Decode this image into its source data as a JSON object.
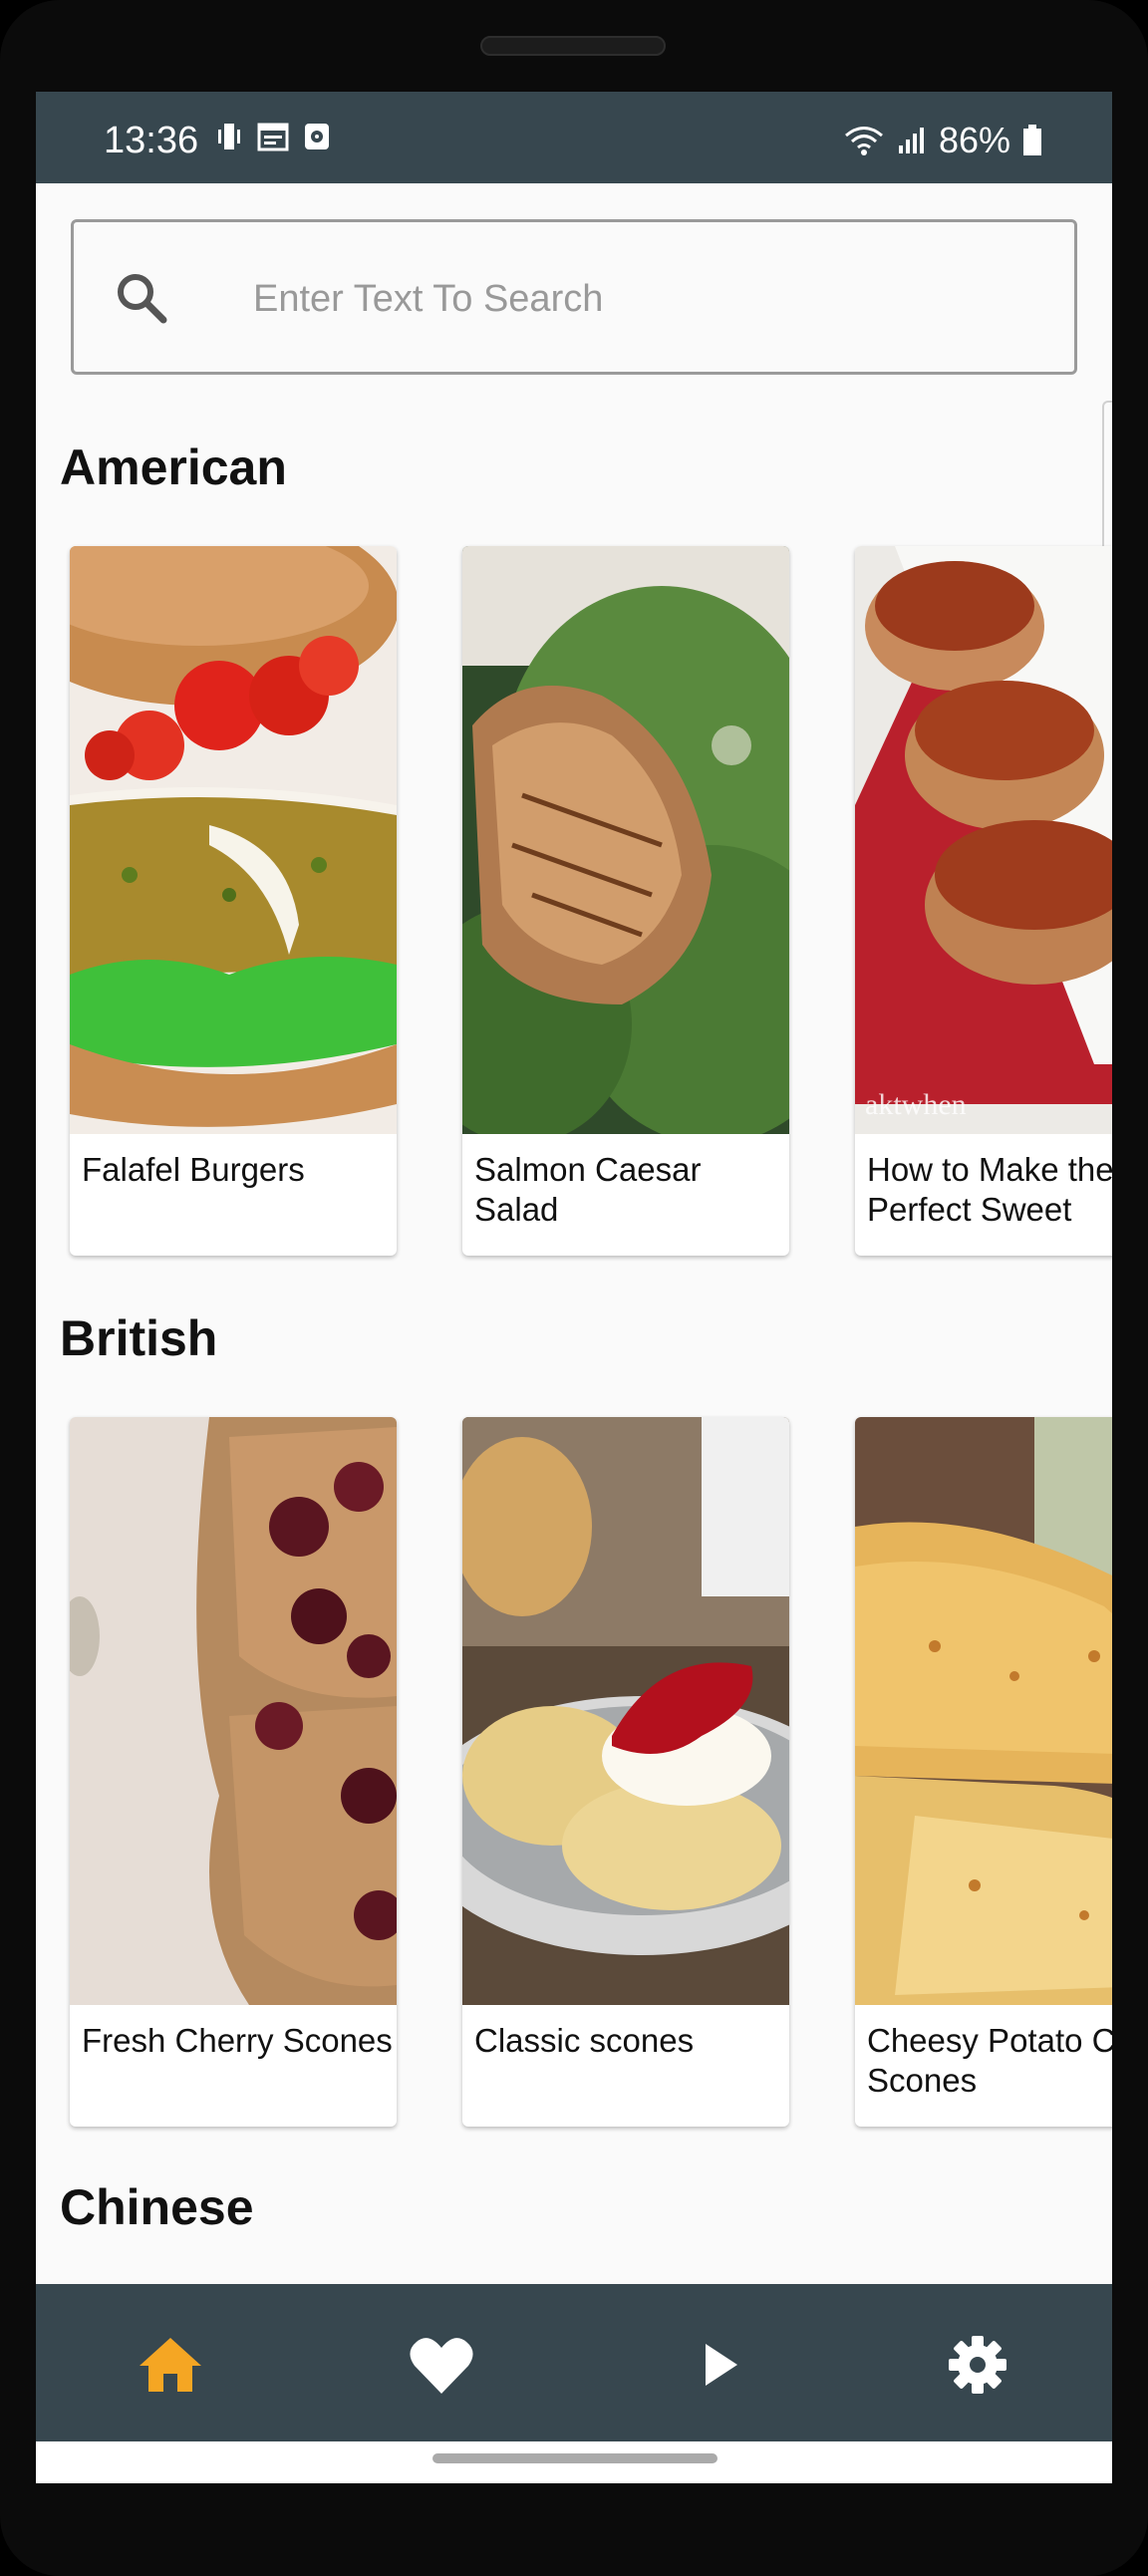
{
  "status_bar": {
    "time": "13:36",
    "battery": "86%"
  },
  "search": {
    "placeholder": "Enter Text To Search"
  },
  "sections": [
    {
      "title": "American",
      "cards": [
        {
          "title": "Falafel Burgers"
        },
        {
          "title": "Salmon Caesar Salad"
        },
        {
          "title": "How to Make the Perfect Sweet"
        }
      ]
    },
    {
      "title": "British",
      "cards": [
        {
          "title": "Fresh Cherry Scones"
        },
        {
          "title": "Classic scones"
        },
        {
          "title": "Cheesy Potato Cc Scones"
        }
      ]
    },
    {
      "title": "Chinese",
      "cards": []
    }
  ],
  "bottom_nav": {
    "items": [
      {
        "icon": "home-icon",
        "active": true
      },
      {
        "icon": "heart-icon",
        "active": false
      },
      {
        "icon": "play-icon",
        "active": false
      },
      {
        "icon": "gear-icon",
        "active": false
      }
    ],
    "active_color": "#f5a623",
    "inactive_color": "#ffffff",
    "background": "#37474f"
  }
}
